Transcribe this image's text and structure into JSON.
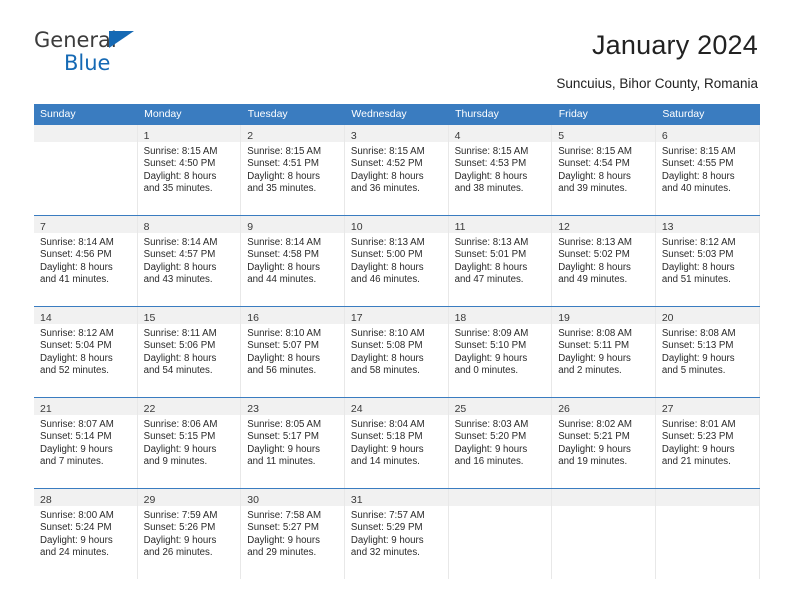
{
  "logo": {
    "word1": "General",
    "word2": "Blue",
    "triangle_color": "#1569b4"
  },
  "header": {
    "title": "January 2024",
    "subtitle": "Suncuius, Bihor County, Romania",
    "accent_color": "#3a7cc0"
  },
  "calendar": {
    "weekday_headers": [
      "Sunday",
      "Monday",
      "Tuesday",
      "Wednesday",
      "Thursday",
      "Friday",
      "Saturday"
    ],
    "labels": {
      "sunrise_prefix": "Sunrise: ",
      "sunset_prefix": "Sunset: ",
      "daylight_prefix": "Daylight: "
    },
    "weeks": [
      [
        {
          "day": "",
          "sunrise": "",
          "sunset": "",
          "daylight_line1": "",
          "daylight_line2": ""
        },
        {
          "day": "1",
          "sunrise": "Sunrise: 8:15 AM",
          "sunset": "Sunset: 4:50 PM",
          "daylight_line1": "Daylight: 8 hours",
          "daylight_line2": "and 35 minutes."
        },
        {
          "day": "2",
          "sunrise": "Sunrise: 8:15 AM",
          "sunset": "Sunset: 4:51 PM",
          "daylight_line1": "Daylight: 8 hours",
          "daylight_line2": "and 35 minutes."
        },
        {
          "day": "3",
          "sunrise": "Sunrise: 8:15 AM",
          "sunset": "Sunset: 4:52 PM",
          "daylight_line1": "Daylight: 8 hours",
          "daylight_line2": "and 36 minutes."
        },
        {
          "day": "4",
          "sunrise": "Sunrise: 8:15 AM",
          "sunset": "Sunset: 4:53 PM",
          "daylight_line1": "Daylight: 8 hours",
          "daylight_line2": "and 38 minutes."
        },
        {
          "day": "5",
          "sunrise": "Sunrise: 8:15 AM",
          "sunset": "Sunset: 4:54 PM",
          "daylight_line1": "Daylight: 8 hours",
          "daylight_line2": "and 39 minutes."
        },
        {
          "day": "6",
          "sunrise": "Sunrise: 8:15 AM",
          "sunset": "Sunset: 4:55 PM",
          "daylight_line1": "Daylight: 8 hours",
          "daylight_line2": "and 40 minutes."
        }
      ],
      [
        {
          "day": "7",
          "sunrise": "Sunrise: 8:14 AM",
          "sunset": "Sunset: 4:56 PM",
          "daylight_line1": "Daylight: 8 hours",
          "daylight_line2": "and 41 minutes."
        },
        {
          "day": "8",
          "sunrise": "Sunrise: 8:14 AM",
          "sunset": "Sunset: 4:57 PM",
          "daylight_line1": "Daylight: 8 hours",
          "daylight_line2": "and 43 minutes."
        },
        {
          "day": "9",
          "sunrise": "Sunrise: 8:14 AM",
          "sunset": "Sunset: 4:58 PM",
          "daylight_line1": "Daylight: 8 hours",
          "daylight_line2": "and 44 minutes."
        },
        {
          "day": "10",
          "sunrise": "Sunrise: 8:13 AM",
          "sunset": "Sunset: 5:00 PM",
          "daylight_line1": "Daylight: 8 hours",
          "daylight_line2": "and 46 minutes."
        },
        {
          "day": "11",
          "sunrise": "Sunrise: 8:13 AM",
          "sunset": "Sunset: 5:01 PM",
          "daylight_line1": "Daylight: 8 hours",
          "daylight_line2": "and 47 minutes."
        },
        {
          "day": "12",
          "sunrise": "Sunrise: 8:13 AM",
          "sunset": "Sunset: 5:02 PM",
          "daylight_line1": "Daylight: 8 hours",
          "daylight_line2": "and 49 minutes."
        },
        {
          "day": "13",
          "sunrise": "Sunrise: 8:12 AM",
          "sunset": "Sunset: 5:03 PM",
          "daylight_line1": "Daylight: 8 hours",
          "daylight_line2": "and 51 minutes."
        }
      ],
      [
        {
          "day": "14",
          "sunrise": "Sunrise: 8:12 AM",
          "sunset": "Sunset: 5:04 PM",
          "daylight_line1": "Daylight: 8 hours",
          "daylight_line2": "and 52 minutes."
        },
        {
          "day": "15",
          "sunrise": "Sunrise: 8:11 AM",
          "sunset": "Sunset: 5:06 PM",
          "daylight_line1": "Daylight: 8 hours",
          "daylight_line2": "and 54 minutes."
        },
        {
          "day": "16",
          "sunrise": "Sunrise: 8:10 AM",
          "sunset": "Sunset: 5:07 PM",
          "daylight_line1": "Daylight: 8 hours",
          "daylight_line2": "and 56 minutes."
        },
        {
          "day": "17",
          "sunrise": "Sunrise: 8:10 AM",
          "sunset": "Sunset: 5:08 PM",
          "daylight_line1": "Daylight: 8 hours",
          "daylight_line2": "and 58 minutes."
        },
        {
          "day": "18",
          "sunrise": "Sunrise: 8:09 AM",
          "sunset": "Sunset: 5:10 PM",
          "daylight_line1": "Daylight: 9 hours",
          "daylight_line2": "and 0 minutes."
        },
        {
          "day": "19",
          "sunrise": "Sunrise: 8:08 AM",
          "sunset": "Sunset: 5:11 PM",
          "daylight_line1": "Daylight: 9 hours",
          "daylight_line2": "and 2 minutes."
        },
        {
          "day": "20",
          "sunrise": "Sunrise: 8:08 AM",
          "sunset": "Sunset: 5:13 PM",
          "daylight_line1": "Daylight: 9 hours",
          "daylight_line2": "and 5 minutes."
        }
      ],
      [
        {
          "day": "21",
          "sunrise": "Sunrise: 8:07 AM",
          "sunset": "Sunset: 5:14 PM",
          "daylight_line1": "Daylight: 9 hours",
          "daylight_line2": "and 7 minutes."
        },
        {
          "day": "22",
          "sunrise": "Sunrise: 8:06 AM",
          "sunset": "Sunset: 5:15 PM",
          "daylight_line1": "Daylight: 9 hours",
          "daylight_line2": "and 9 minutes."
        },
        {
          "day": "23",
          "sunrise": "Sunrise: 8:05 AM",
          "sunset": "Sunset: 5:17 PM",
          "daylight_line1": "Daylight: 9 hours",
          "daylight_line2": "and 11 minutes."
        },
        {
          "day": "24",
          "sunrise": "Sunrise: 8:04 AM",
          "sunset": "Sunset: 5:18 PM",
          "daylight_line1": "Daylight: 9 hours",
          "daylight_line2": "and 14 minutes."
        },
        {
          "day": "25",
          "sunrise": "Sunrise: 8:03 AM",
          "sunset": "Sunset: 5:20 PM",
          "daylight_line1": "Daylight: 9 hours",
          "daylight_line2": "and 16 minutes."
        },
        {
          "day": "26",
          "sunrise": "Sunrise: 8:02 AM",
          "sunset": "Sunset: 5:21 PM",
          "daylight_line1": "Daylight: 9 hours",
          "daylight_line2": "and 19 minutes."
        },
        {
          "day": "27",
          "sunrise": "Sunrise: 8:01 AM",
          "sunset": "Sunset: 5:23 PM",
          "daylight_line1": "Daylight: 9 hours",
          "daylight_line2": "and 21 minutes."
        }
      ],
      [
        {
          "day": "28",
          "sunrise": "Sunrise: 8:00 AM",
          "sunset": "Sunset: 5:24 PM",
          "daylight_line1": "Daylight: 9 hours",
          "daylight_line2": "and 24 minutes."
        },
        {
          "day": "29",
          "sunrise": "Sunrise: 7:59 AM",
          "sunset": "Sunset: 5:26 PM",
          "daylight_line1": "Daylight: 9 hours",
          "daylight_line2": "and 26 minutes."
        },
        {
          "day": "30",
          "sunrise": "Sunrise: 7:58 AM",
          "sunset": "Sunset: 5:27 PM",
          "daylight_line1": "Daylight: 9 hours",
          "daylight_line2": "and 29 minutes."
        },
        {
          "day": "31",
          "sunrise": "Sunrise: 7:57 AM",
          "sunset": "Sunset: 5:29 PM",
          "daylight_line1": "Daylight: 9 hours",
          "daylight_line2": "and 32 minutes."
        },
        {
          "day": "",
          "sunrise": "",
          "sunset": "",
          "daylight_line1": "",
          "daylight_line2": ""
        },
        {
          "day": "",
          "sunrise": "",
          "sunset": "",
          "daylight_line1": "",
          "daylight_line2": ""
        },
        {
          "day": "",
          "sunrise": "",
          "sunset": "",
          "daylight_line1": "",
          "daylight_line2": ""
        }
      ]
    ]
  }
}
